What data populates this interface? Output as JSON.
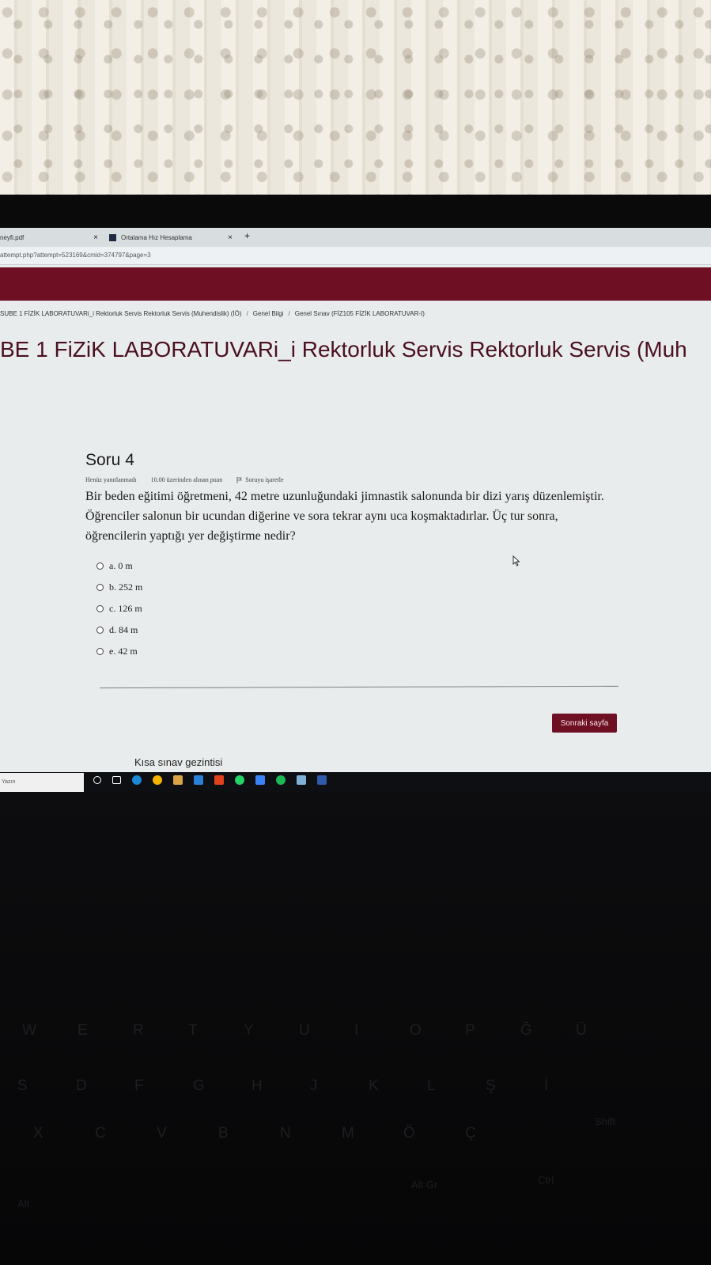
{
  "browser": {
    "tabs": [
      {
        "label": "neyfi.pdf",
        "close": "×"
      },
      {
        "label": "Ortalama Hız Hesaplama",
        "close": "×"
      }
    ],
    "new_tab": "+",
    "url": "attempt.php?attempt=523169&cmid=374797&page=3"
  },
  "breadcrumb": [
    "SUBE 1 FİZİK LABORATUVARi_i Rektorluk Servis Rektorluk Servis (Muhendislik) (İÖ)",
    "Genel Bilgi",
    "Genel Sınav (FİZ105 FİZİK LABORATUVAR-I)"
  ],
  "breadcrumb_sep": "/",
  "page_title": "BE 1 FiZiK LABORATUVARi_i Rektorluk Servis Rektorluk Servis (Muh",
  "question": {
    "heading": "Soru 4",
    "status": "Henüz yanıtlanmadı",
    "points": "10.00 üzerinden alınan puan",
    "flag_label": "Soruyu işaretle",
    "text": "Bir beden eğitimi öğretmeni, 42 metre uzunluğundaki jimnastik salonunda bir dizi yarış düzenlemiştir. Öğrenciler salonun bir ucundan diğerine ve sora tekrar aynı uca koşmaktadırlar. Üç tur sonra, öğrencilerin yaptığı yer değiştirme nedir?",
    "options": [
      {
        "label": "a. 0 m"
      },
      {
        "label": "b. 252 m"
      },
      {
        "label": "c. 126 m"
      },
      {
        "label": "d. 84 m"
      },
      {
        "label": "e. 42 m"
      }
    ]
  },
  "next_button": "Sonraki sayfa",
  "quiz_nav_title": "Kısa sınav gezintisi",
  "taskbar": {
    "search_text": "Yazın",
    "icons": [
      "cortana-icon",
      "taskview-icon",
      "edge-icon",
      "chrome-icon",
      "file-explorer-icon",
      "mail-icon",
      "office-icon",
      "whatsapp-icon",
      "todo-icon",
      "spotify-icon",
      "app-icon",
      "desktop-icon"
    ],
    "icon_colors": [
      "#ffffff",
      "#ffffff",
      "#1e88d6",
      "#f4b400",
      "#d9a441",
      "#2a7fd6",
      "#e2421b",
      "#25d366",
      "#3b82f6",
      "#1db954",
      "#7fb0d8",
      "#2f5aa8"
    ]
  },
  "keyboard": {
    "row1": [
      "W",
      "E",
      "R",
      "T",
      "Y",
      "U",
      "I",
      "O",
      "P",
      "Ğ",
      "Ü"
    ],
    "row2": [
      "S",
      "D",
      "F",
      "G",
      "H",
      "J",
      "K",
      "L",
      "Ş",
      "İ"
    ],
    "row3": [
      "X",
      "C",
      "V",
      "B",
      "N",
      "M",
      "Ö",
      "Ç"
    ],
    "misc": [
      "Alt Gr",
      "Ctrl",
      "Shift",
      "Alt"
    ]
  },
  "colors": {
    "accent": "#6e0f24",
    "screen_bg": "#e9ecec"
  }
}
